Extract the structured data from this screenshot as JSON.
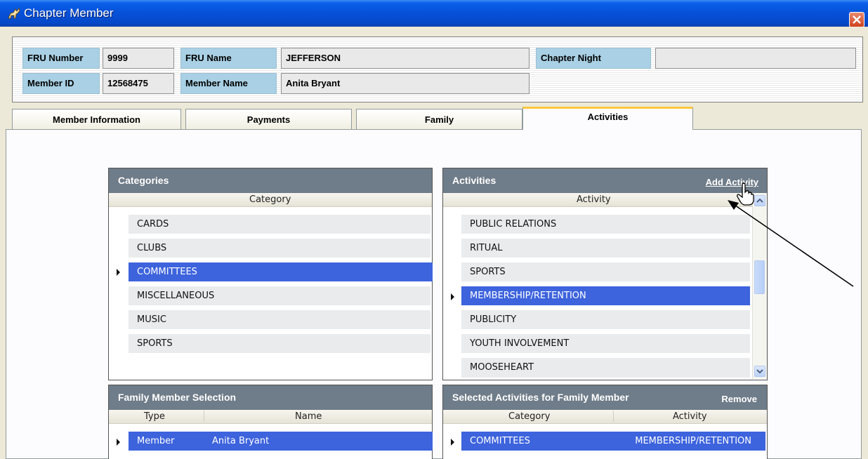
{
  "window": {
    "title": "Chapter Member"
  },
  "info": {
    "fru_number_label": "FRU Number",
    "fru_number": "9999",
    "fru_name_label": "FRU Name",
    "fru_name": "JEFFERSON",
    "chapter_night_label": "Chapter Night",
    "chapter_night": "",
    "member_id_label": "Member ID",
    "member_id": "12568475",
    "member_name_label": "Member Name",
    "member_name": "Anita Bryant"
  },
  "tabs": [
    {
      "label": "Member Information"
    },
    {
      "label": "Payments"
    },
    {
      "label": "Family"
    },
    {
      "label": "Activities",
      "active": true
    }
  ],
  "categories": {
    "title": "Categories",
    "column": "Category",
    "rows": [
      "CARDS",
      "CLUBS",
      "COMMITTEES",
      "MISCELLANEOUS",
      "MUSIC",
      "SPORTS"
    ],
    "selected": "COMMITTEES"
  },
  "activities": {
    "title": "Activities",
    "add_label": "Add Activity",
    "column": "Activity",
    "rows": [
      "PUBLIC RELATIONS",
      "RITUAL",
      "SPORTS",
      "MEMBERSHIP/RETENTION",
      "PUBLICITY",
      "YOUTH INVOLVEMENT",
      "MOOSEHEART"
    ],
    "selected": "MEMBERSHIP/RETENTION"
  },
  "family": {
    "title": "Family Member Selection",
    "col_type": "Type",
    "col_name": "Name",
    "rows": [
      {
        "type": "Member",
        "name": "Anita Bryant"
      }
    ]
  },
  "selected_activities": {
    "title": "Selected Activities for Family Member",
    "remove_label": "Remove",
    "col_category": "Category",
    "col_activity": "Activity",
    "rows": [
      {
        "category": "COMMITTEES",
        "activity": "MEMBERSHIP/RETENTION"
      }
    ]
  },
  "colors": {
    "titlebar": "#0650d8",
    "selection": "#3d63dd",
    "grid_header": "#6f7c89",
    "label_bg": "#a9d0e4",
    "tab_accent": "#ffc83c"
  }
}
